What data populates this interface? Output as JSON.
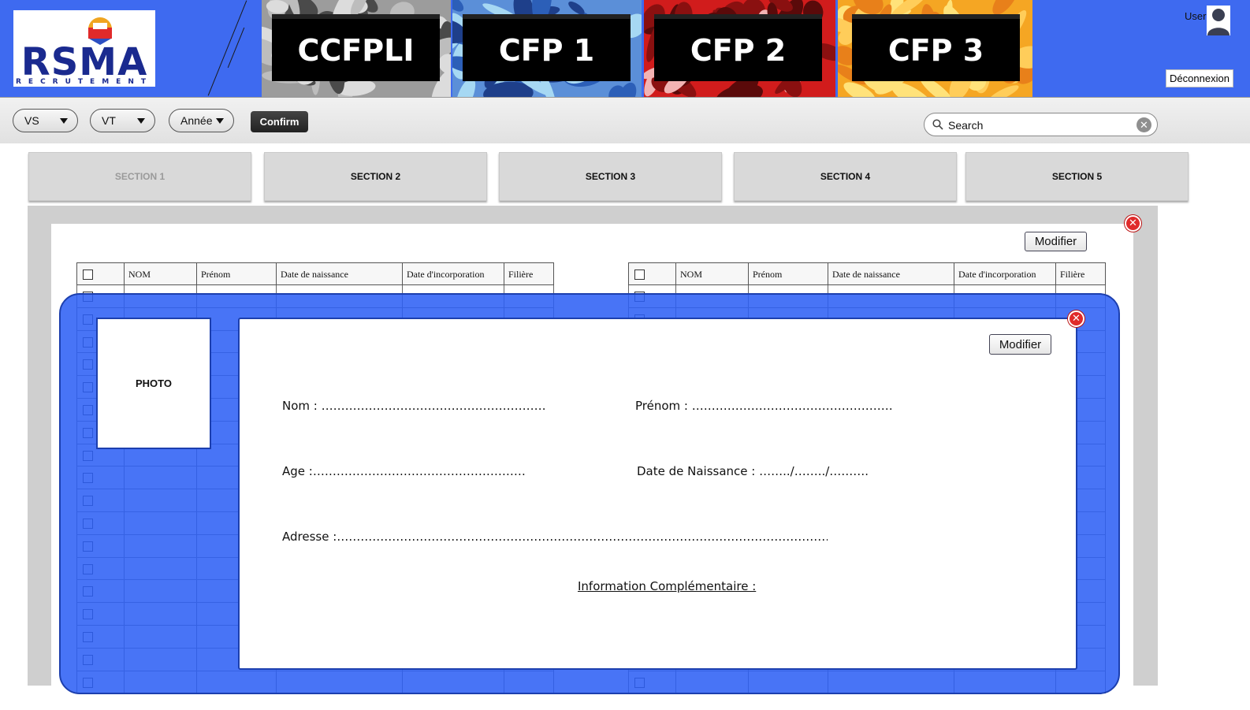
{
  "header": {
    "logo": {
      "text": "RSMA",
      "subtext": "RECRUTEMENT"
    },
    "tiles": [
      {
        "label": "CCFPLI",
        "camo": [
          "#9c9c9c",
          "#dcdcdc",
          "#4a4a4a",
          "#bdbdbd"
        ]
      },
      {
        "label": "CFP 1",
        "camo": [
          "#5b8fd8",
          "#a6d8f3",
          "#1e3f8a",
          "#2c5fb8"
        ]
      },
      {
        "label": "CFP 2",
        "camo": [
          "#d11c1c",
          "#5a0a0a",
          "#f2b3b3",
          "#8a1010"
        ]
      },
      {
        "label": "CFP 3",
        "camo": [
          "#f5a623",
          "#ffe27a",
          "#e8801a",
          "#ffcd5a"
        ]
      }
    ],
    "user_label": "User",
    "logout_label": "Déconnexion"
  },
  "filters": {
    "vs": "VS",
    "vt": "VT",
    "annee": "Année",
    "confirm_label": "Confirm",
    "search_placeholder": "Search"
  },
  "sections": [
    "SECTION 1",
    "SECTION 2",
    "SECTION 3",
    "SECTION 4",
    "SECTION 5"
  ],
  "panel": {
    "modify_label": "Modifier",
    "table_headers": [
      "",
      "NOM",
      "Prénom",
      "Date de naissance",
      "Date d'incorporation",
      "Filière"
    ],
    "row_count": 18
  },
  "modal": {
    "photo_label": "PHOTO",
    "modify_label": "Modifier",
    "nom": "Nom : …………………………………………………",
    "prenom": "Prénom : ……………………………………………",
    "age": "Age :………………………………………………",
    "date_naissance": "Date de Naissance : ……../……../……….",
    "adresse": "Adresse :……………………………………………………………………………………………………………………",
    "info": "Information Complémentaire :"
  },
  "colors": {
    "header_blue": "#3e6af0",
    "overlay_blue": "#2d5ff5"
  }
}
